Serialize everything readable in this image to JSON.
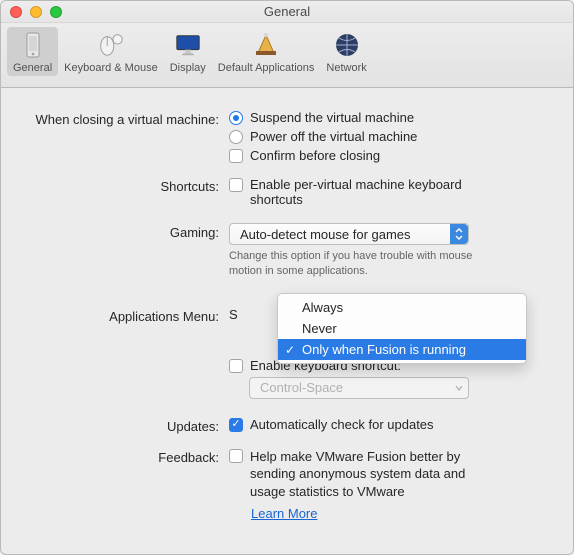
{
  "window": {
    "title": "General"
  },
  "toolbar": {
    "items": [
      {
        "label": "General"
      },
      {
        "label": "Keyboard & Mouse"
      },
      {
        "label": "Display"
      },
      {
        "label": "Default Applications"
      },
      {
        "label": "Network"
      }
    ]
  },
  "close_section": {
    "label": "When closing a virtual machine:",
    "opt1": "Suspend the virtual machine",
    "opt2": "Power off the virtual machine",
    "opt3": "Confirm before closing"
  },
  "shortcuts": {
    "label": "Shortcuts:",
    "opt": "Enable per-virtual machine keyboard shortcuts"
  },
  "gaming": {
    "label": "Gaming:",
    "value": "Auto-detect mouse for games",
    "hint": "Change this option if you have trouble with mouse motion in some applications."
  },
  "appmenu": {
    "label": "Applications Menu:",
    "prefix": "S",
    "enable_kb": "Enable keyboard shortcut:",
    "kb_value": "Control-Space",
    "options": {
      "o1": "Always",
      "o2": "Never",
      "o3": "Only when Fusion is running"
    }
  },
  "updates": {
    "label": "Updates:",
    "opt": "Automatically check for updates"
  },
  "feedback": {
    "label": "Feedback:",
    "opt": "Help make VMware Fusion better by sending anonymous system data and usage statistics to VMware",
    "link": "Learn More"
  }
}
